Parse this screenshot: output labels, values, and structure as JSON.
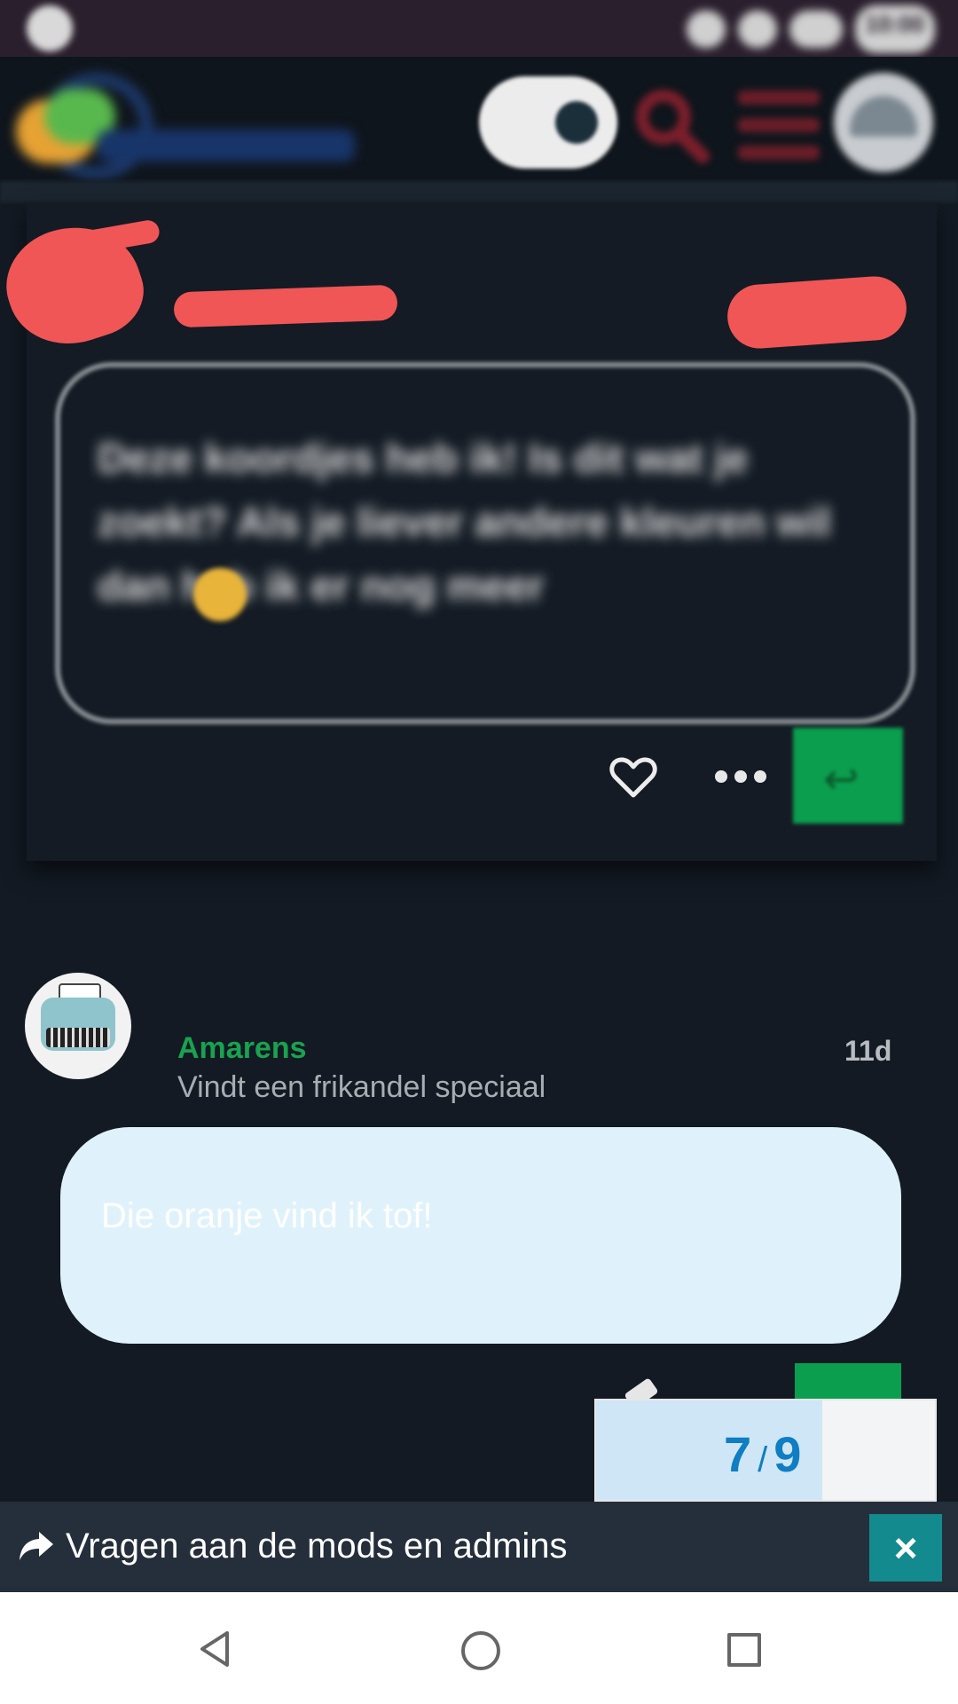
{
  "status_bar": {
    "time": "10:00"
  },
  "header": {
    "logo_icon": "forum-logo",
    "toggle_icon": "toggle-switch-icon",
    "search_icon": "search-icon",
    "menu_icon": "hamburger-menu-icon",
    "avatar_icon": "user-avatar"
  },
  "posts": [
    {
      "body": "Deze koordjes heb ik! Is dit wat je zoekt? Als je liever andere kleuren wil dan heb ik er nog meer",
      "actions": {
        "like_icon": "heart-icon",
        "more_icon": "more-dots-icon",
        "reply_icon": "reply-icon"
      }
    },
    {
      "username": "Amarens",
      "user_title": "Vindt een frikandel speciaal",
      "age": "11d",
      "body": "Die oranje vind ik tof!"
    }
  ],
  "progress": {
    "current": "7",
    "separator": "/",
    "total": "9"
  },
  "topic_banner": {
    "title": "Vragen aan de mods en admins",
    "icon": "share-arrow-icon",
    "close_label": "×"
  },
  "navbar": {
    "back_icon": "back-triangle-icon",
    "home_icon": "home-circle-icon",
    "recents_icon": "recents-square-icon"
  },
  "colors": {
    "accent_green": "#0b9e4f",
    "username_green": "#19a24f",
    "counter_blue": "#0f7ec2",
    "close_teal": "#138a8e"
  }
}
